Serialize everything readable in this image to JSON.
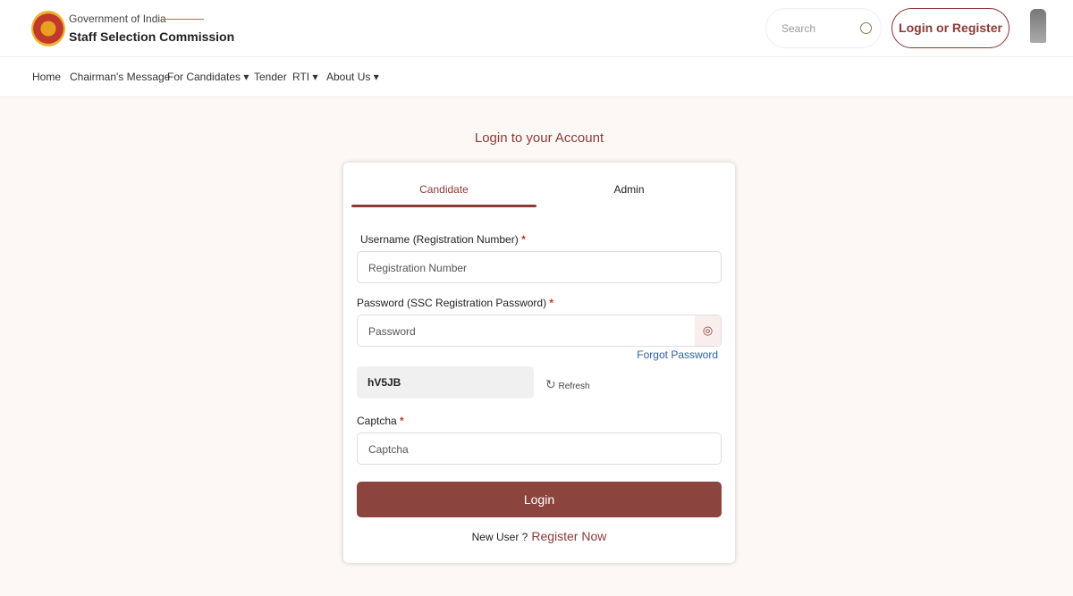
{
  "header": {
    "gov": "Government of India",
    "org": "Staff Selection Commission",
    "search_placeholder": "Search",
    "login_register": "Login or Register"
  },
  "nav": [
    {
      "label": "Home"
    },
    {
      "label": "Chairman's Message"
    },
    {
      "label": "For Candidates ▾"
    },
    {
      "label": "Tender"
    },
    {
      "label": "RTI ▾"
    },
    {
      "label": "About Us ▾"
    }
  ],
  "page_title": "Login to your Account",
  "tabs": {
    "candidate": "Candidate",
    "admin": "Admin"
  },
  "form": {
    "username_label": "Username (Registration Number)",
    "username_placeholder": "Registration Number",
    "password_label": "Password (SSC Registration Password)",
    "password_placeholder": "Password",
    "forgot": "Forgot Password",
    "captcha_code": "hV5JB",
    "refresh": "Refresh",
    "captcha_label": "Captcha",
    "captcha_placeholder": "Captcha",
    "required": "*",
    "login": "Login",
    "new_user": "New User ?",
    "register": "Register Now"
  }
}
